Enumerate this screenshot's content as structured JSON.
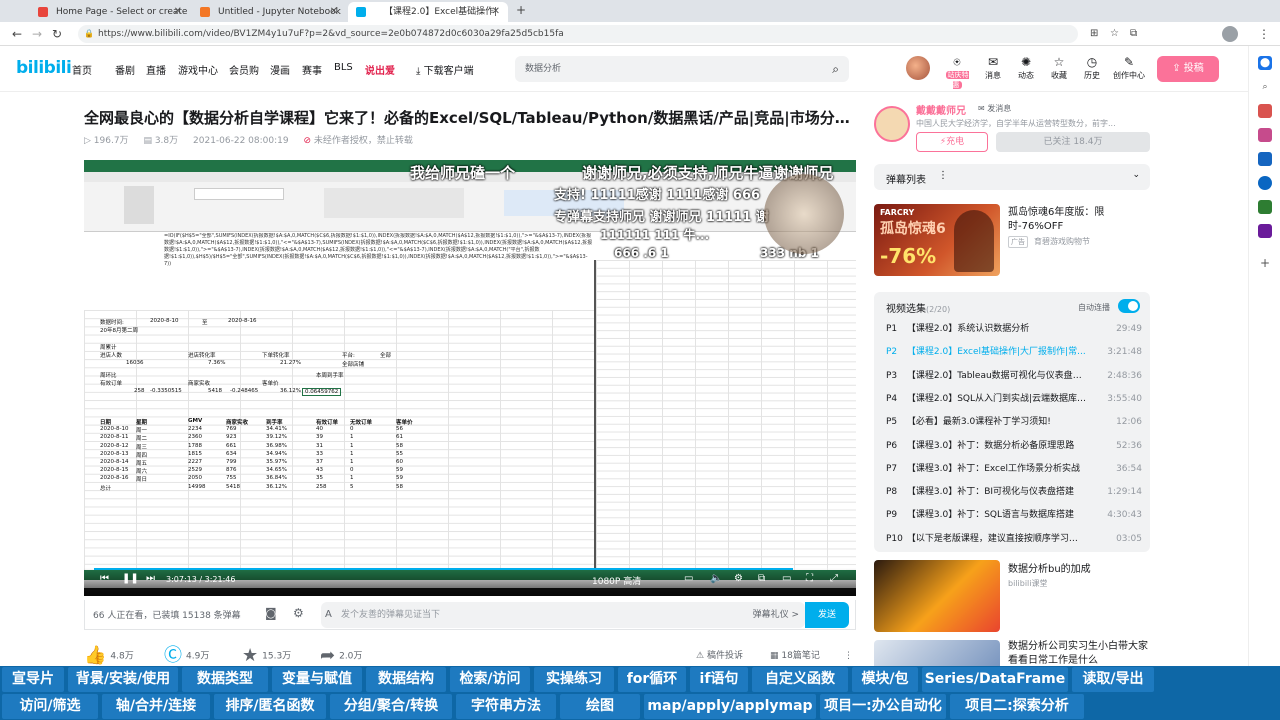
{
  "browser": {
    "tabs": [
      {
        "title": "Home Page - Select or create a n"
      },
      {
        "title": "Untitled - Jupyter Notebook"
      },
      {
        "title": "【课程2.0】Excel基础操作|"
      }
    ],
    "url": "https://www.bilibili.com/video/BV1ZM4y1u7uF?p=2&vd_source=2e0b074872d0c6030a29fa25d5cb15fa"
  },
  "header": {
    "logo": "bilibili",
    "nav": [
      "首页",
      "番剧",
      "直播",
      "游戏中心",
      "会员购",
      "漫画",
      "赛事",
      "BLS",
      "说出爱",
      "下载客户端"
    ],
    "search_placeholder": "数据分析",
    "icons": [
      {
        "icon": "vip-icon",
        "label": "站庆特惠"
      },
      {
        "icon": "message-icon",
        "label": "消息"
      },
      {
        "icon": "dynamic-icon",
        "label": "动态"
      },
      {
        "icon": "favorite-icon",
        "label": "收藏"
      },
      {
        "icon": "history-icon",
        "label": "历史"
      },
      {
        "icon": "creator-icon",
        "label": "创作中心"
      }
    ],
    "upload": "投稿"
  },
  "video": {
    "title": "全网最良心的【数据分析自学课程】它来了！必备的Excel/SQL/Tableau/Python/数据黑话/产品|竞品|市场分析报告制...",
    "views": "196.7万",
    "danmaku_count": "3.8万",
    "date": "2021-06-22 08:00:19",
    "copyright": "未经作者授权，禁止转载",
    "time": "3:07:13 / 3:21:46",
    "quality": "1080P 高清",
    "progress": 0.93
  },
  "danmaku_overlay": [
    "我给师兄磕一个",
    "谢谢师兄,必须支持,师兄牛逼谢谢师兄",
    "支持! 11111感谢 1111感谢 666",
    "专弹幕支持师兄 谢谢师兄 11111 谢",
    "111111 111 牛...",
    "666 .6 1",
    "333 nb 1"
  ],
  "excel_rows": [
    [
      "数据时间:",
      "2020-8-10",
      "至",
      "2020-8-16"
    ],
    [
      "20年8月第二周"
    ],
    [
      "周累计"
    ],
    [
      "进店人数",
      "",
      "进店转化率",
      "",
      "下单转化率",
      "平台:",
      "全部"
    ],
    [
      "16036",
      "",
      "7.36%",
      "",
      "21.27%",
      "全部店铺"
    ],
    [
      "周环比"
    ],
    [
      "有效订单",
      "",
      "商家实收",
      "",
      "客单价",
      "本周到手率"
    ],
    [
      "258",
      "-0.3350515",
      "5418",
      "-0.248465",
      "36.12%",
      "0.06459762"
    ]
  ],
  "excel_week": [
    [
      "日期",
      "星期",
      "GMV",
      "商家实收",
      "到手率",
      "有效订单",
      "无效订单",
      "客单价"
    ],
    [
      "2020-8-10",
      "周一",
      "2234",
      "769",
      "34.41%",
      "40",
      "0",
      "56"
    ],
    [
      "2020-8-11",
      "周二",
      "2360",
      "923",
      "39.12%",
      "39",
      "1",
      "61"
    ],
    [
      "2020-8-12",
      "周三",
      "1788",
      "661",
      "36.98%",
      "31",
      "1",
      "58"
    ],
    [
      "2020-8-13",
      "周四",
      "1815",
      "634",
      "34.94%",
      "33",
      "1",
      "55"
    ],
    [
      "2020-8-14",
      "周五",
      "2227",
      "799",
      "35.97%",
      "37",
      "1",
      "60"
    ],
    [
      "2020-8-15",
      "周六",
      "2529",
      "876",
      "34.65%",
      "43",
      "0",
      "59"
    ],
    [
      "2020-8-16",
      "周日",
      "2050",
      "755",
      "36.84%",
      "35",
      "1",
      "59"
    ],
    [
      "总计",
      "",
      "14998",
      "5418",
      "36.12%",
      "258",
      "5",
      "58"
    ]
  ],
  "danmaku_bar": {
    "watching": "66 人正在看，已装填 15138 条弹幕",
    "placeholder": "发个友善的弹幕见证当下",
    "etiquette": "弹幕礼仪 >",
    "send": "发送"
  },
  "actions": [
    {
      "icon": "like-icon",
      "value": "4.8万"
    },
    {
      "icon": "coin-icon",
      "value": "4.9万"
    },
    {
      "icon": "star-icon",
      "value": "15.3万"
    },
    {
      "icon": "share-icon",
      "value": "2.0万"
    }
  ],
  "actions_right": [
    "稿件投诉",
    "18篇笔记"
  ],
  "up": {
    "name": "戴戴戴师兄",
    "message": "发消息",
    "desc": "中国人民大学经济学，自学半年从运营转型数分，前字...",
    "charge": "充电",
    "followed": "已关注 18.4万"
  },
  "danmaku_list": {
    "label": "弹幕列表"
  },
  "ad": {
    "title": "孤岛惊魂6年度版：限时-76%OFF",
    "badge": "广告",
    "source": "育碧游戏购物节",
    "poster_text": "孤岛惊魂6",
    "discount": "-76%"
  },
  "episodes": {
    "label": "视频选集",
    "count": "(2/20)",
    "autoplay": "自动连播",
    "items": [
      {
        "p": "P1",
        "title": "【课程2.0】系统认识数据分析",
        "dur": "29:49"
      },
      {
        "p": "P2",
        "title": "【课程2.0】Excel基础操作|大厂报制作|常...",
        "dur": "3:21:48",
        "current": true
      },
      {
        "p": "P3",
        "title": "【课程2.0】Tableau数据可视化与仪表盘搭建",
        "dur": "2:48:36"
      },
      {
        "p": "P4",
        "title": "【课程2.0】SQL从入门到实战|云端数据库搭建...",
        "dur": "3:55:40"
      },
      {
        "p": "P5",
        "title": "【必看】最新3.0课程补丁学习须知!",
        "dur": "12:06"
      },
      {
        "p": "P6",
        "title": "【课程3.0】补丁：数据分析必备原理思路",
        "dur": "52:36"
      },
      {
        "p": "P7",
        "title": "【课程3.0】补丁：Excel工作场景分析实战",
        "dur": "36:54"
      },
      {
        "p": "P8",
        "title": "【课程3.0】补丁：BI可视化与仪表盘搭建",
        "dur": "1:29:14"
      },
      {
        "p": "P9",
        "title": "【课程3.0】补丁：SQL语言与数据库搭建",
        "dur": "4:30:43"
      },
      {
        "p": "P10",
        "title": "【以下是老版课程，建议直接按顺序学习上面的...",
        "dur": "03:05"
      }
    ]
  },
  "recs": [
    {
      "title": "数据分析bu的加成",
      "author": "bilibili课堂"
    },
    {
      "title": "数据分析公司实习生小白带大家看看日常工作是什么"
    }
  ],
  "topics_row1": [
    "宣导片",
    "背景/安装/使用",
    "数据类型",
    "变量与赋值",
    "数据结构",
    "检索/访问",
    "实操练习",
    "for循环",
    "if语句",
    "自定义函数",
    "模块/包",
    "Series/DataFrame",
    "读取/导出"
  ],
  "topics_row2": [
    "访问/筛选",
    "轴/合并/连接",
    "排序/匿名函数",
    "分组/聚合/转换",
    "字符串方法",
    "绘图",
    "map/apply/applymap",
    "项目一:办公自动化",
    "项目二:探索分析"
  ],
  "colors": {
    "brand": "#00aeec",
    "pink": "#fb7299",
    "topic_bar": "#0e67a6",
    "excel": "#217346"
  }
}
